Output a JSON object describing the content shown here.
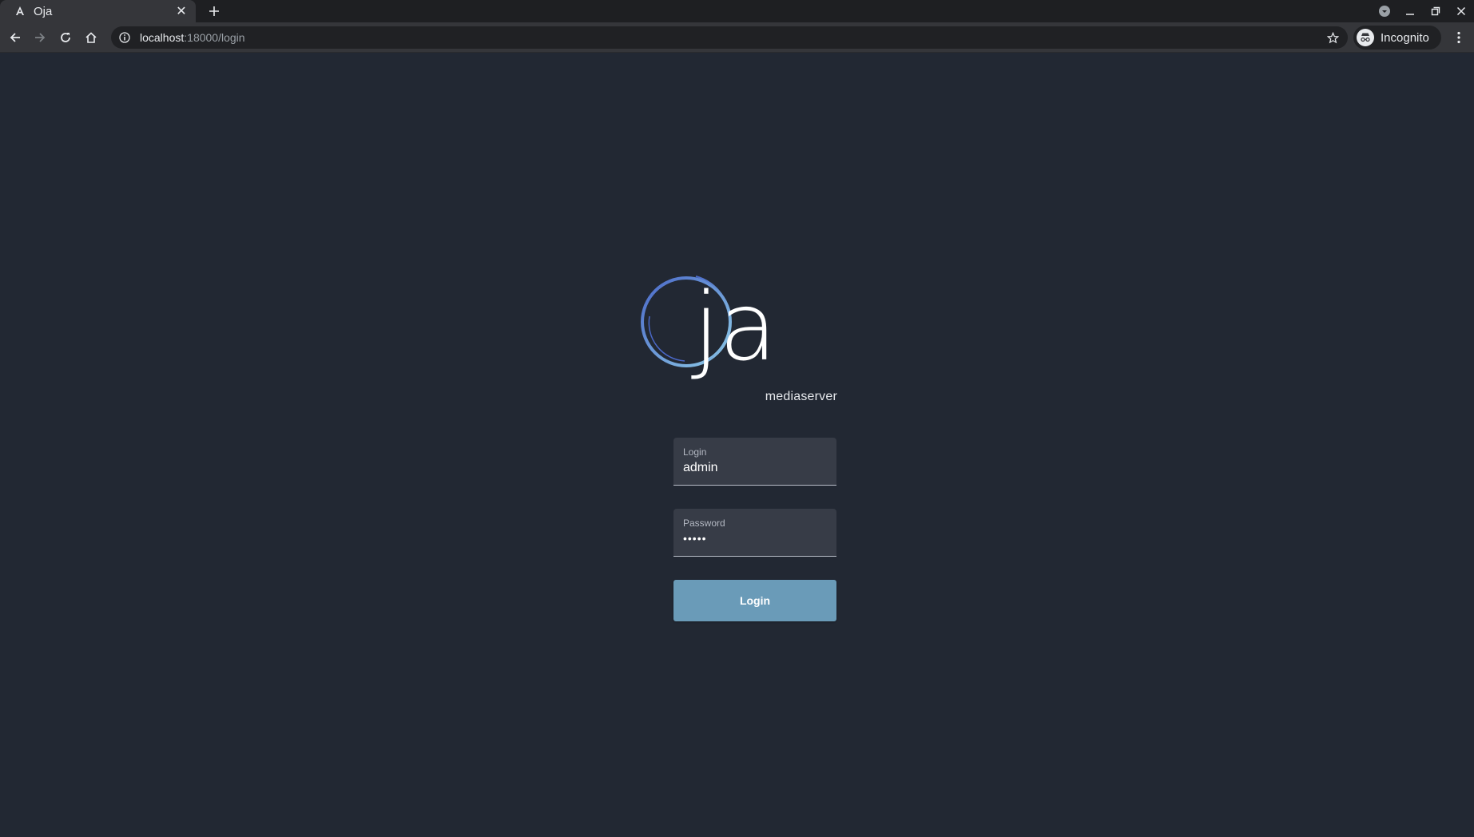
{
  "browser": {
    "tab": {
      "title": "Oja",
      "favicon": "angular-icon"
    },
    "address": {
      "host": "localhost",
      "rest": ":18000/login"
    },
    "profile_label": "Incognito"
  },
  "logo": {
    "wordmark": "ja",
    "subtitle": "mediaserver"
  },
  "form": {
    "login_label": "Login",
    "login_value": "admin",
    "password_label": "Password",
    "password_value": "•••••",
    "submit_label": "Login"
  },
  "colors": {
    "page_background": "#222833",
    "field_background": "#373c47",
    "button": "#6a9bb8",
    "logo_gradient_start": "#4a68c8",
    "logo_gradient_end": "#8ecbe8"
  }
}
